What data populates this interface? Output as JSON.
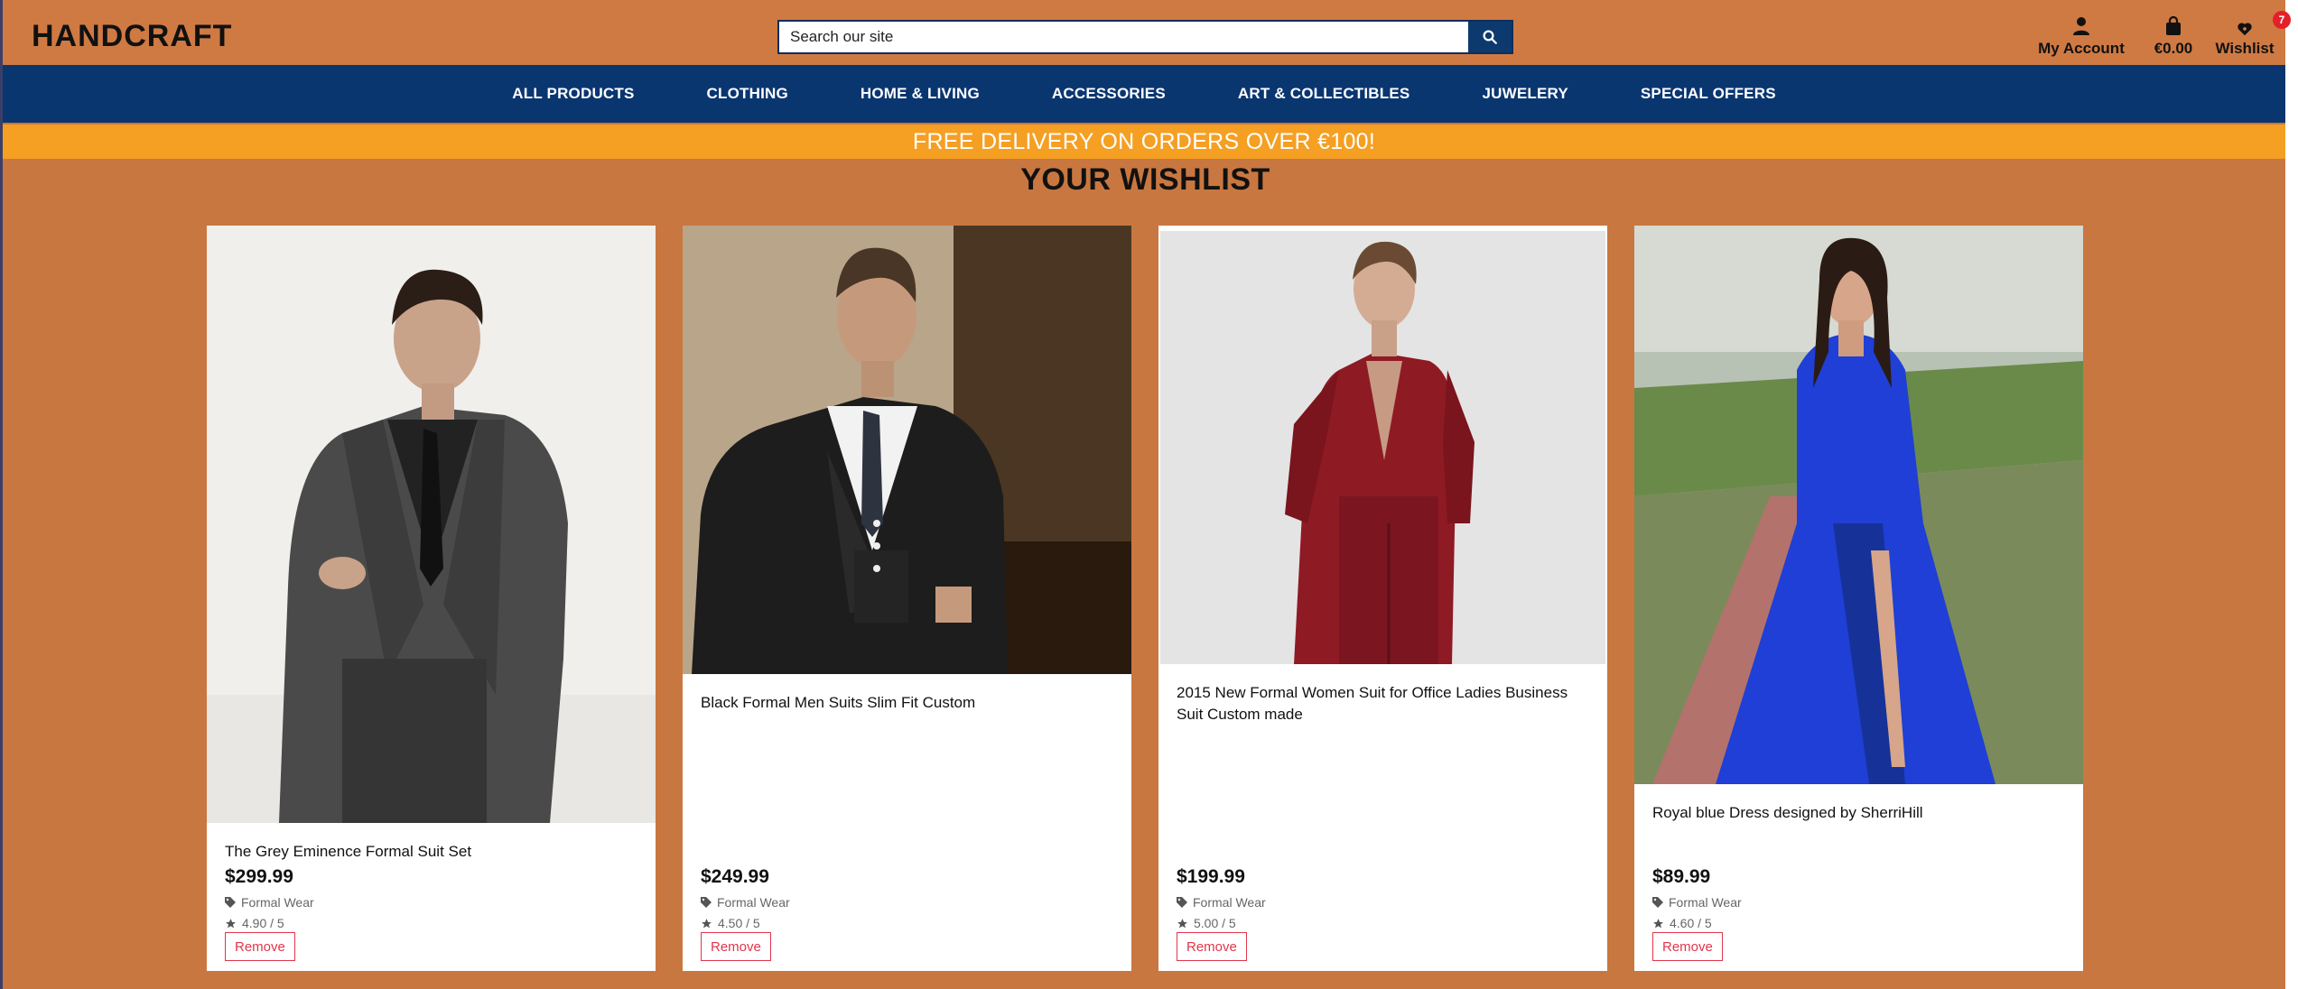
{
  "header": {
    "logo": "HANDCRAFT",
    "search_placeholder": "Search our site",
    "account_label": "My Account",
    "cart_label": "€0.00",
    "wishlist_label": "Wishlist",
    "wishlist_count": "7"
  },
  "nav": {
    "items": [
      "ALL PRODUCTS",
      "CLOTHING",
      "HOME & LIVING",
      "ACCESSORIES",
      "ART & COLLECTIBLES",
      "JUWELERY",
      "SPECIAL OFFERS"
    ]
  },
  "promo": "FREE DELIVERY ON ORDERS OVER €100!",
  "page_title": "YOUR WISHLIST",
  "products": [
    {
      "name": "The Grey Eminence Formal Suit Set",
      "price": "$299.99",
      "category": "Formal Wear",
      "rating": "4.90 / 5",
      "remove_label": "Remove"
    },
    {
      "name": "Black Formal Men Suits Slim Fit Custom",
      "price": "$249.99",
      "category": "Formal Wear",
      "rating": "4.50 / 5",
      "remove_label": "Remove"
    },
    {
      "name": "2015 New Formal Women Suit for Office Ladies Business Suit Custom made",
      "price": "$199.99",
      "category": "Formal Wear",
      "rating": "5.00 / 5",
      "remove_label": "Remove"
    },
    {
      "name": "Royal blue Dress designed by SherriHill",
      "price": "$89.99",
      "category": "Formal Wear",
      "rating": "4.60 / 5",
      "remove_label": "Remove"
    }
  ],
  "colors": {
    "page_bg": "#c97740",
    "nav_bg": "#0a3670",
    "promo_bg": "#f59f23",
    "remove": "#e0364b",
    "badge": "#e3202a"
  }
}
